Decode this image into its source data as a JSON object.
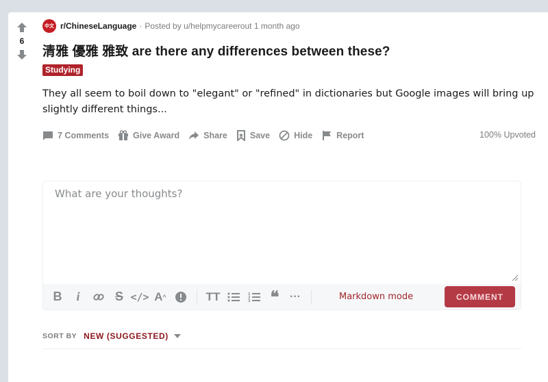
{
  "post": {
    "vote_count": "6",
    "subreddit": "r/ChineseLanguage",
    "subreddit_icon_text": "中文",
    "separator": "·",
    "posted_by": "Posted by",
    "author": "u/helpmycareerout",
    "time_ago": "1 month ago",
    "title": "清雅 優雅 雅致 are there any differences between these?",
    "flair": "Studying",
    "body": "They all seem to boil down to \"elegant\" or \"refined\" in dictionaries but Google images will bring up slightly different things..."
  },
  "actions": {
    "comments": "7 Comments",
    "give_award": "Give Award",
    "share": "Share",
    "save": "Save",
    "hide": "Hide",
    "report": "Report",
    "upvoted": "100% Upvoted"
  },
  "comment_box": {
    "placeholder": "What are your thoughts?",
    "markdown_mode": "Markdown mode",
    "submit_label": "COMMENT",
    "toolbar_icons": [
      "bold-icon",
      "italic-icon",
      "link-icon",
      "strikethrough-icon",
      "inline-code-icon",
      "superscript-icon",
      "spoiler-icon",
      "heading-icon",
      "bulleted-list-icon",
      "numbered-list-icon",
      "quote-icon",
      "more-icon"
    ]
  },
  "sort": {
    "label": "SORT BY",
    "value": "NEW (SUGGESTED)"
  },
  "colors": {
    "background": "#dae0e6",
    "accent": "#b0232b",
    "comment_button": "#b43a46",
    "muted_text": "#878a8c"
  }
}
